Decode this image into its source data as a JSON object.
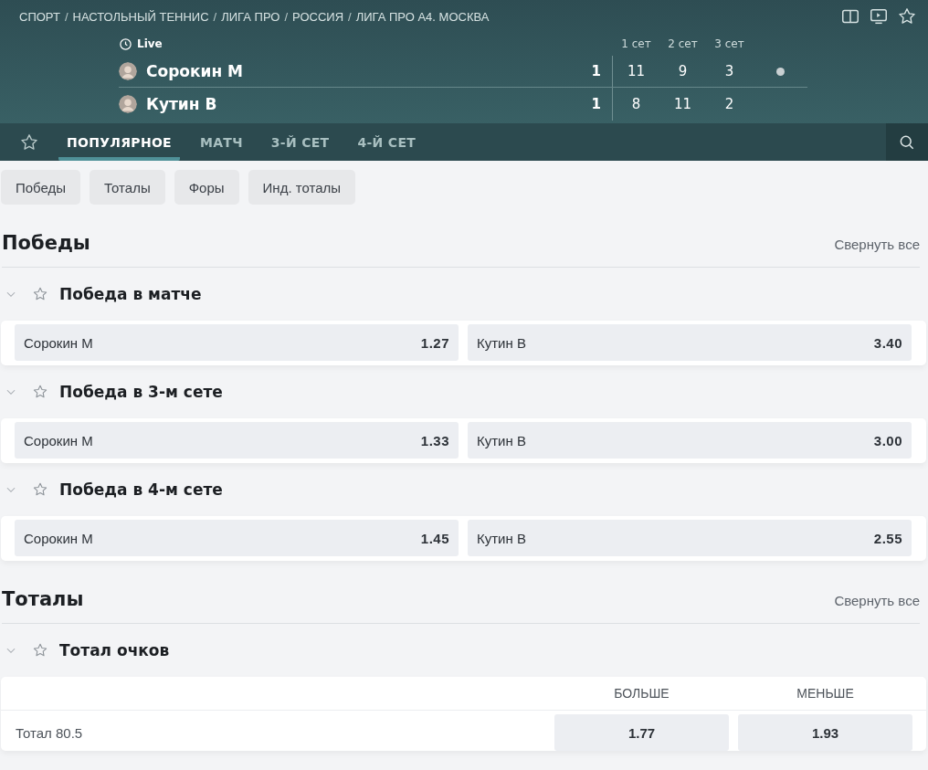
{
  "breadcrumb": {
    "separator": "/",
    "items": [
      "СПОРТ",
      "НАСТОЛЬНЫЙ ТЕННИС",
      "ЛИГА ПРО",
      "РОССИЯ",
      "ЛИГА ПРО А4. МОСКВА"
    ]
  },
  "match": {
    "status": "Live",
    "set_labels": [
      "1 сет",
      "2 сет",
      "3 сет"
    ],
    "players": [
      {
        "name": "Сорокин М",
        "score": "1",
        "sets": [
          "11",
          "9",
          "3"
        ],
        "serving": true
      },
      {
        "name": "Кутин В",
        "score": "1",
        "sets": [
          "8",
          "11",
          "2"
        ],
        "serving": false
      }
    ]
  },
  "tabs": [
    {
      "label": "ПОПУЛЯРНОЕ",
      "selected": true
    },
    {
      "label": "МАТЧ",
      "selected": false
    },
    {
      "label": "3-Й СЕТ",
      "selected": false
    },
    {
      "label": "4-Й СЕТ",
      "selected": false
    }
  ],
  "filters": [
    "Победы",
    "Тоталы",
    "Форы",
    "Инд. тоталы"
  ],
  "sections": [
    {
      "title": "Победы",
      "collapse_label": "Свернуть все",
      "markets": [
        {
          "title": "Победа в матче",
          "expanded": true,
          "kind": "two-way",
          "outcomes": [
            {
              "name": "Сорокин М",
              "odds": "1.27"
            },
            {
              "name": "Кутин В",
              "odds": "3.40"
            }
          ]
        },
        {
          "title": "Победа в 3-м сете",
          "expanded": true,
          "kind": "two-way",
          "outcomes": [
            {
              "name": "Сорокин М",
              "odds": "1.33"
            },
            {
              "name": "Кутин В",
              "odds": "3.00"
            }
          ]
        },
        {
          "title": "Победа в 4-м сете",
          "expanded": true,
          "kind": "two-way",
          "outcomes": [
            {
              "name": "Сорокин М",
              "odds": "1.45"
            },
            {
              "name": "Кутин В",
              "odds": "2.55"
            }
          ]
        }
      ]
    },
    {
      "title": "Тоталы",
      "collapse_label": "Свернуть все",
      "markets": [
        {
          "title": "Тотал очков",
          "expanded": true,
          "kind": "table",
          "columns": [
            "БОЛЬШЕ",
            "МЕНЬШЕ"
          ],
          "rows": [
            {
              "label": "Тотал 80.5",
              "odds": [
                "1.77",
                "1.93"
              ]
            }
          ]
        }
      ]
    }
  ]
}
